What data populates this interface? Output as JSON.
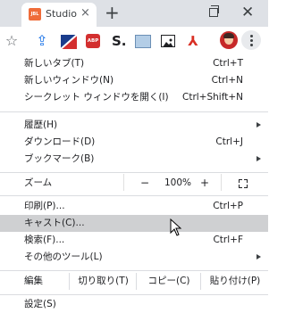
{
  "tab": {
    "favicon_text": "JBL",
    "title": "Studio",
    "close": "×"
  },
  "tabstrip": {
    "newtab": "+",
    "close": "✕"
  },
  "toolbar": {
    "star": "☆",
    "share_icon": "⇪",
    "abp": "ABP",
    "s_ext": "S.",
    "pdf_icon": "⅄"
  },
  "menu": {
    "new_tab": {
      "label": "新しいタブ(T)",
      "shortcut": "Ctrl+T"
    },
    "new_window": {
      "label": "新しいウィンドウ(N)",
      "shortcut": "Ctrl+N"
    },
    "incognito": {
      "label": "シークレット ウィンドウを開く(I)",
      "shortcut": "Ctrl+Shift+N"
    },
    "history": {
      "label": "履歴(H)"
    },
    "downloads": {
      "label": "ダウンロード(D)",
      "shortcut": "Ctrl+J"
    },
    "bookmarks": {
      "label": "ブックマーク(B)"
    },
    "zoom": {
      "label": "ズーム",
      "minus": "−",
      "value": "100%",
      "plus": "+"
    },
    "print": {
      "label": "印刷(P)...",
      "shortcut": "Ctrl+P"
    },
    "cast": {
      "label": "キャスト(C)..."
    },
    "find": {
      "label": "検索(F)...",
      "shortcut": "Ctrl+F"
    },
    "more_tools": {
      "label": "その他のツール(L)"
    },
    "edit": {
      "label": "編集",
      "cut": "切り取り(T)",
      "copy": "コピー(C)",
      "paste": "貼り付け(P)"
    },
    "settings": {
      "label": "設定(S)"
    }
  },
  "colors": {
    "hover_row": "#cfd0d2",
    "tabstrip": "#dee1e6"
  }
}
